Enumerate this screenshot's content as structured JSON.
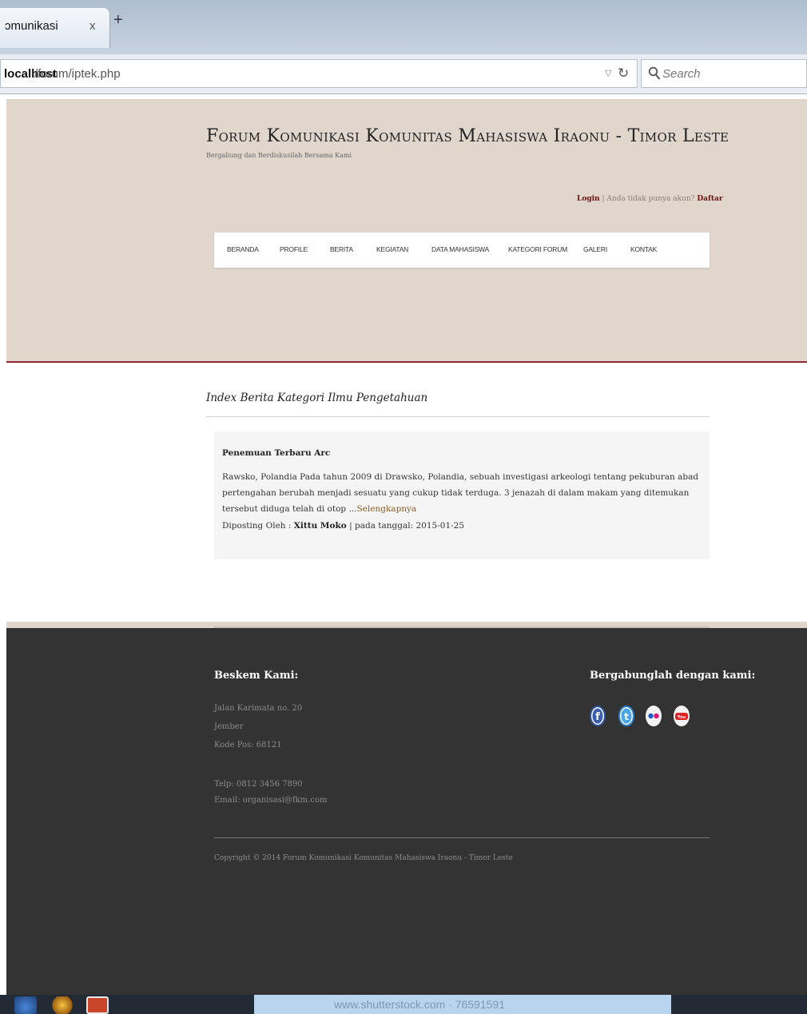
{
  "browser": {
    "tab_title": "ɔmunikasi",
    "tab_close": "x",
    "new_tab": "+",
    "url_host": "localhost",
    "url_path": "/forum/iptek.php",
    "search_placeholder": "Search"
  },
  "header": {
    "title": "Forum Komunikasi Komunitas Mahasiswa Iraonu - Timor Leste",
    "tagline": "Bergabung dan Berdiskusilah Bersama Kami",
    "login_label": "Login",
    "auth_separator": "| Anda tidak punya akun?",
    "register_label": "Daftar"
  },
  "menu": [
    "BERANDA",
    "PROFILE",
    "BERITA",
    "KEGIATAN",
    "DATA MAHASISWA",
    "KATEGORI FORUM",
    "GALERI",
    "KONTAK"
  ],
  "content": {
    "index_title": "Index Berita Kategori Ilmu Pengetahuan",
    "post": {
      "title": "Penemuan Terbaru Arc",
      "body": "Rawsko, Polandia Pada tahun 2009 di Drawsko, Polandia, sebuah investigasi arkeologi tentang pekuburan abad pertengahan berubah menjadi sesuatu yang cukup tidak terduga. 3 jenazah di dalam makam yang ditemukan tersebut diduga telah di otop ...",
      "read_more": "Selengkapnya",
      "meta_prefix": "Diposting Oleh : ",
      "author": "Xittu Moko",
      "meta_date": " | pada tanggal: 2015-01-25"
    }
  },
  "footer": {
    "basecamp_heading": "Beskem Kami:",
    "address_line1": "Jalan Karimata no. 20",
    "address_line2": "Jember",
    "postal": "Kode Pos: 68121",
    "phone": "Telp: 0812 3456 7890",
    "email": "Email: organisasi@fkm.com",
    "join_heading": "Bergabunglah dengan kami:",
    "social_icons": [
      "facebook-icon",
      "twitter-icon",
      "flickr-icon",
      "youtube-icon"
    ],
    "copyright": "Copyright © 2014 Forum Komunikasi Komunitas Mahasiswa Iraonu - Timor Leste"
  },
  "taskbar": {
    "banner_text": "www.shutterstock.com · 76591591"
  },
  "colors": {
    "header_bg": "#e0d6cc",
    "accent": "#8b2b2b",
    "footer_bg": "#333333"
  }
}
